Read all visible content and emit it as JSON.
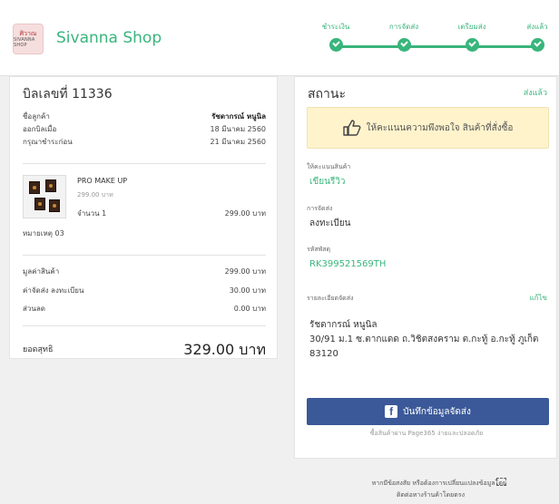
{
  "shop": {
    "logo_text_top": "ศิวาณ",
    "logo_text_bottom": "SIVANNA SHOP",
    "name": "Sivanna Shop"
  },
  "steps": [
    {
      "label": "ชำระเงิน"
    },
    {
      "label": "การจัดส่ง"
    },
    {
      "label": "เตรียมส่ง"
    },
    {
      "label": "ส่งแล้ว"
    }
  ],
  "bill": {
    "title": "บิลเลขที่ 11336",
    "customer_label": "ชื่อลูกค้า",
    "customer_value": "รัชดากรณ์ หนูนิล",
    "issued_label": "ออกบิลเมื่อ",
    "issued_value": "18 มีนาคม 2560",
    "due_label": "กรุณาชำระก่อน",
    "due_value": "21 มีนาคม 2560",
    "product": {
      "name": "PRO MAKE UP",
      "unit_price": "299.00 บาท",
      "qty_label": "จำนวน 1",
      "line_total": "299.00 บาท"
    },
    "note": "หมายเหตุ  03",
    "subtotal_label": "มูลค่าสินค้า",
    "subtotal_value": "299.00 บาท",
    "shipping_label": "ค่าจัดส่ง  ลงทะเบียน",
    "shipping_value": "30.00 บาท",
    "discount_label": "ส่วนลด",
    "discount_value": "0.00 บาท",
    "total_label": "ยอดสุทธิ",
    "total_value": "329.00 บาท"
  },
  "status": {
    "title": "สถานะ",
    "value": "ส่งแล้ว",
    "rating_prompt": "ให้คะแนนความพึงพอใจ สินค้าที่สั่งซื้อ",
    "review_label": "ให้คะแนนสินค้า",
    "review_link": "เขียนรีวิว",
    "shipping_method_label": "การจัดส่ง",
    "shipping_method_value": "ลงทะเบียน",
    "tracking_label": "รหัสพัสดุ",
    "tracking_value": "RK399521569TH",
    "address_label": "รายละเอียดจัดส่ง",
    "edit_label": "แก้ไข",
    "address_name": "รัชดากรณ์ หนูนิล",
    "address_line1": "30/91 ม.1 ซ.ตากแดด ถ.วิชิตสงคราม ต.กะทู้ อ.กะทู้ ภูเก็ต",
    "address_line2": "83120",
    "fb_button_label": "บันทึกข้อมูลจัดส่ง",
    "powered_by": "ซื้อสินค้าผ่าน Page365 ง่ายและปลอดภัย"
  },
  "footer": {
    "line1": "หากมีข้อสงสัย หรือต้องการเปลี่ยนแปลงข้อมูลโดย",
    "line2": "ติดต่อทางร้านค้าโดยตรง"
  },
  "colors": {
    "accent": "#39b57c",
    "facebook": "#3b5998",
    "rating_bg": "#fff3cc"
  },
  "icons": [
    "check-icon",
    "thumbs-up-icon",
    "facebook-icon"
  ]
}
